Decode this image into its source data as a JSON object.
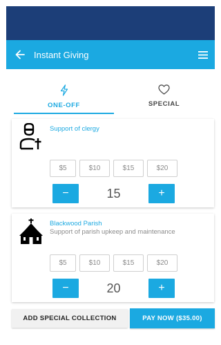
{
  "header": {
    "title": "Instant Giving",
    "back_icon": "arrow-left-icon",
    "menu_icon": "hamburger-menu-icon"
  },
  "tabs": [
    {
      "label": "ONE-OFF",
      "icon": "lightning-icon",
      "active": true
    },
    {
      "label": "SPECIAL",
      "icon": "heart-icon",
      "active": false
    }
  ],
  "cards": [
    {
      "icon": "clergy-icon",
      "title": "Support of clergy",
      "description": "",
      "amounts": [
        "$5",
        "$10",
        "$15",
        "$20"
      ],
      "quantity": "15",
      "minus_label": "−",
      "plus_label": "+"
    },
    {
      "icon": "church-icon",
      "title": "Blackwood Parish",
      "description": "Support of parish upkeep and maintenance",
      "amounts": [
        "$5",
        "$10",
        "$15",
        "$20"
      ],
      "quantity": "20",
      "minus_label": "−",
      "plus_label": "+"
    }
  ],
  "footer": {
    "add_label": "ADD SPECIAL COLLECTION",
    "pay_label": "PAY NOW ($35.00)"
  },
  "colors": {
    "primary": "#1ba9e1",
    "status_bar": "#1c3e78"
  }
}
